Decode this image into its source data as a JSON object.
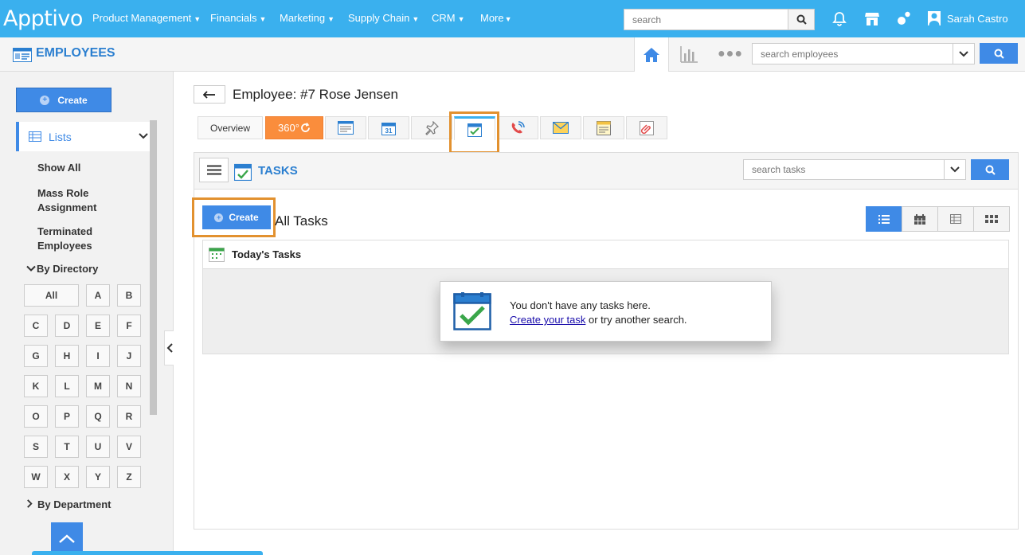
{
  "topnav": {
    "logo": "Apptivo",
    "menus": [
      "Product Management",
      "Financials",
      "Marketing",
      "Supply Chain",
      "CRM",
      "More"
    ],
    "search_placeholder": "search",
    "user_name": "Sarah Castro"
  },
  "module": {
    "title": "EMPLOYEES",
    "search_placeholder": "search employees"
  },
  "sidebar": {
    "create_label": "Create",
    "lists_label": "Lists",
    "links": [
      "Show All",
      "Mass Role Assignment",
      "Terminated Employees"
    ],
    "by_directory": "By Directory",
    "all_label": "All",
    "letters": [
      "A",
      "B",
      "C",
      "D",
      "E",
      "F",
      "G",
      "H",
      "I",
      "J",
      "K",
      "L",
      "M",
      "N",
      "O",
      "P",
      "Q",
      "R",
      "S",
      "T",
      "U",
      "V",
      "W",
      "X",
      "Y",
      "Z"
    ],
    "by_department": "By Department"
  },
  "employee": {
    "title": "Employee: #7 Rose Jensen",
    "tabs": {
      "overview": "Overview",
      "t360": "360°"
    }
  },
  "tasks": {
    "title": "TASKS",
    "search_placeholder": "search tasks",
    "create_label": "Create",
    "list_title": "All Tasks",
    "section_title": "Today's Tasks",
    "empty_line1": "You don't have any tasks here.",
    "empty_link": "Create your task",
    "empty_rest": " or try another search."
  },
  "colors": {
    "nav": "#3ab0ee",
    "primary": "#3f8ae6",
    "highlight": "#e2912f",
    "tab360": "#fa8d3c"
  }
}
